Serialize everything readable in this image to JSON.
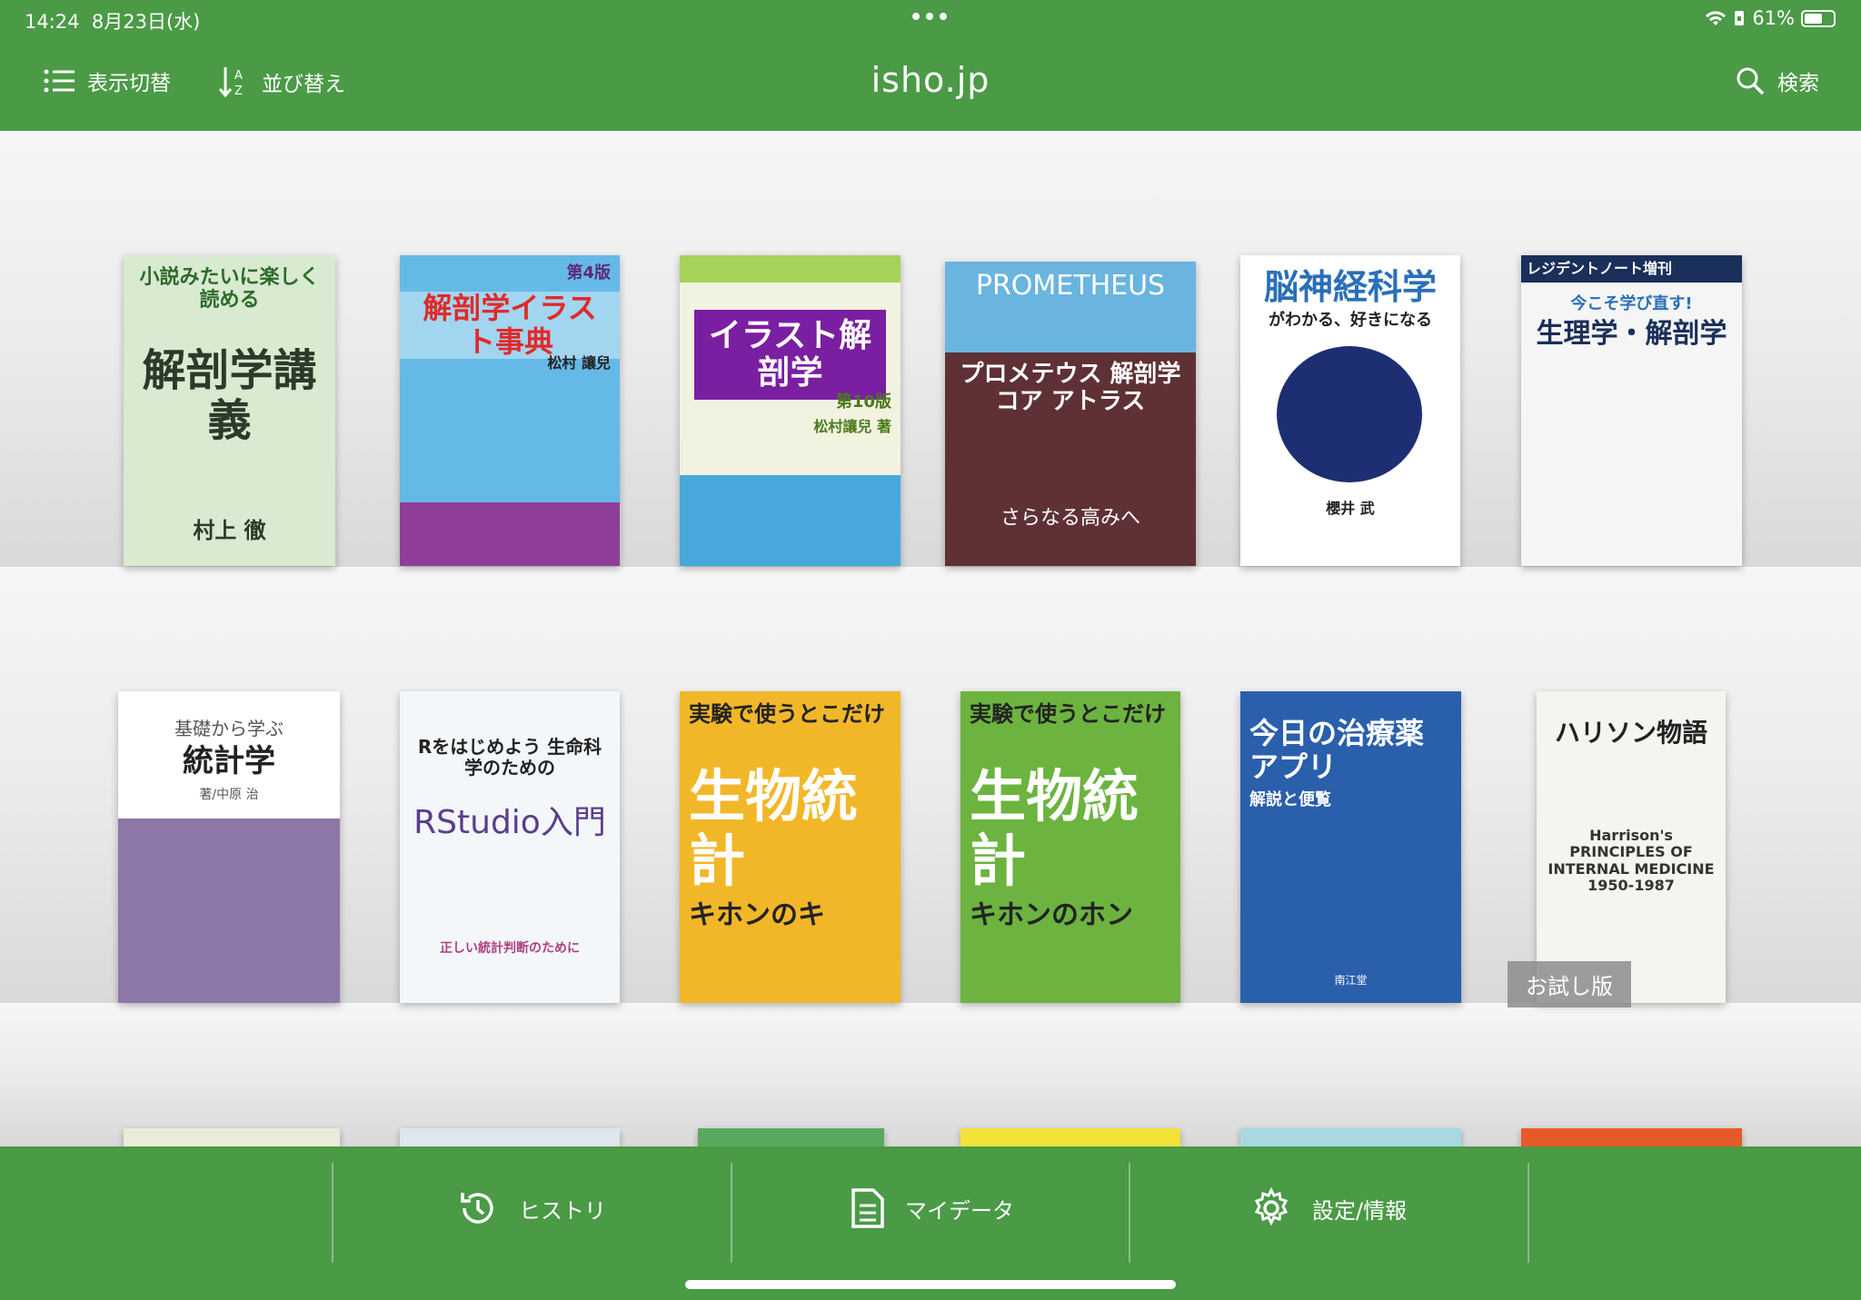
{
  "status": {
    "time": "14:24",
    "date": "8月23日(水)",
    "battery": "61%"
  },
  "nav": {
    "title": "isho.jp",
    "view_toggle": "表示切替",
    "sort": "並び替え",
    "search": "検索"
  },
  "books": [
    {
      "title": "解剖学講義",
      "subtitle": "小説みたいに楽しく読める",
      "author": "村上 徹",
      "bg": "#d8ead0",
      "fg": "#2d3a2a"
    },
    {
      "title": "解剖学イラスト事典",
      "subtitle": "第4版",
      "author": "松村 讓兒",
      "bg": "#65b9e6",
      "fg": "#e02a2a"
    },
    {
      "title": "イラスト解剖学",
      "subtitle": "第10版",
      "author": "松村讓兒 著",
      "bg": "#f2f2e0",
      "fg": "#7a1fa1"
    },
    {
      "title": "PROMETHEUS",
      "subtitle": "プロメテウス 解剖学 コア アトラス",
      "author": "さらなる高みへ",
      "bg": "#5f3134",
      "fg": "#ffffff"
    },
    {
      "title": "脳神経科学",
      "subtitle": "がわかる、好きになる",
      "author": "櫻井 武",
      "bg": "#ffffff",
      "fg": "#2a6fb8"
    },
    {
      "title": "生理学・解剖学",
      "subtitle": "今こそ学び直す!",
      "author": "レジデントノート増刊",
      "bg": "#f5f5f5",
      "fg": "#1a2f5a"
    },
    {
      "title": "統計学",
      "subtitle": "基礎から学ぶ",
      "author": "著/中原 治",
      "bg": "#8d76a8",
      "fg": "#222222"
    },
    {
      "title": "RStudio入門",
      "subtitle": "Rをはじめよう 生命科学のための",
      "author": "正しい統計判断のために",
      "bg": "#f4f7fa",
      "fg": "#5a3e8c"
    },
    {
      "title": "生物統計",
      "subtitle": "実験で使うとこだけ",
      "author": "キホンのキ",
      "bg": "#f2b729",
      "fg": "#ffffff"
    },
    {
      "title": "生物統計",
      "subtitle": "実験で使うとこだけ",
      "author": "キホンのホン",
      "bg": "#6cb33f",
      "fg": "#ffffff"
    },
    {
      "title": "今日の治療薬アプリ",
      "subtitle": "解説と便覧",
      "author": "南江堂",
      "bg": "#2a5fac",
      "fg": "#ffffff"
    },
    {
      "title": "ハリソン物語",
      "subtitle": "Harrison's PRINCIPLES OF INTERNAL MEDICINE 1950-1987",
      "author": "お試し版",
      "bg": "#f6f4f0",
      "fg": "#222222"
    }
  ],
  "trial_label": "お試し版",
  "tabs": {
    "history": "ヒストリ",
    "mydata": "マイデータ",
    "settings": "設定/情報"
  }
}
